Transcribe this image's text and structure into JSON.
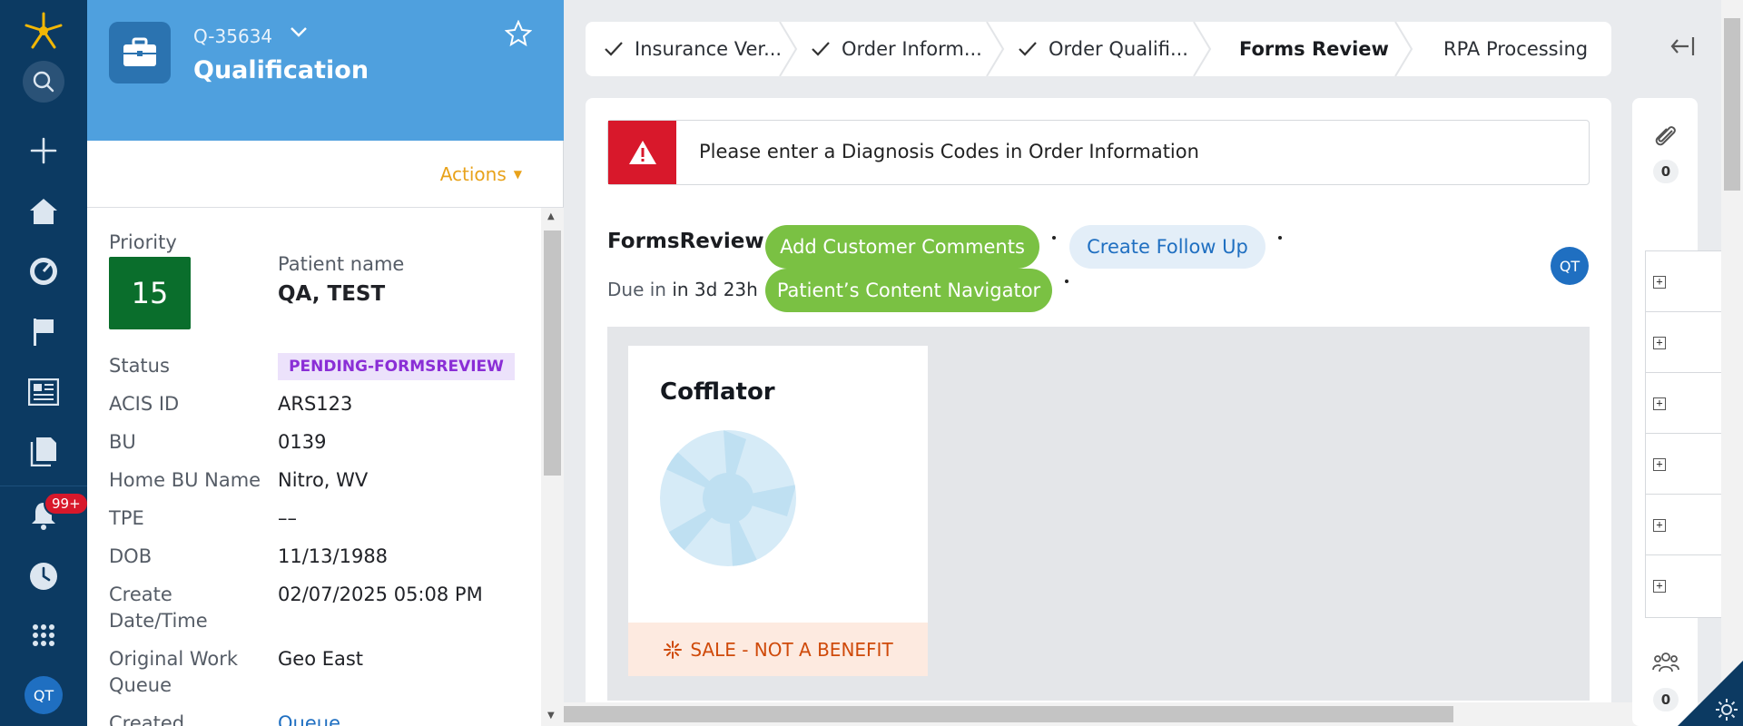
{
  "app": {
    "accent_color": "#0c3a62",
    "notifications_badge": "99+",
    "user_initials": "QT"
  },
  "rail": {
    "icons": [
      "logo-icon",
      "search-icon",
      "plus-icon",
      "home-icon",
      "dashboard-icon",
      "flag-icon",
      "news-icon",
      "documents-icon",
      "bell-icon",
      "history-icon",
      "apps-grid-icon"
    ]
  },
  "case": {
    "id": "Q-35634",
    "title": "Qualification",
    "actions_label": "Actions",
    "priority_label": "Priority",
    "priority_value": "15",
    "patient_name_label": "Patient name",
    "patient_name_value": "QA, TEST",
    "fields": [
      {
        "label": "Status",
        "value": "PENDING-FORMSREVIEW"
      },
      {
        "label": "ACIS ID",
        "value": "ARS123"
      },
      {
        "label": "BU",
        "value": "0139"
      },
      {
        "label": "Home BU Name",
        "value": "Nitro, WV"
      },
      {
        "label": "TPE",
        "value": "––"
      },
      {
        "label": "DOB",
        "value": "11/13/1988"
      },
      {
        "label_line1": "Create",
        "label_line2": "Date/Time",
        "value": "02/07/2025 05:08 PM"
      },
      {
        "label_line1": "Original Work",
        "label_line2": "Queue",
        "value": "Geo East"
      },
      {
        "label": "Created",
        "value": "Queue"
      }
    ]
  },
  "stages": [
    {
      "label": "Insurance Ver...",
      "done": true
    },
    {
      "label": "Order Inform...",
      "done": true
    },
    {
      "label": "Order Qualifi...",
      "done": true
    },
    {
      "label": "Forms Review",
      "done": false,
      "active": true
    },
    {
      "label": "RPA Processing",
      "done": false
    }
  ],
  "alert": {
    "message": "Please enter a Diagnosis Codes in Order Information",
    "color": "#d8182b"
  },
  "forms_review": {
    "title": "FormsReview",
    "due_label": "Due in",
    "due_value": "in 3d 23h",
    "buttons": {
      "add_comments": "Add Customer Comments",
      "create_follow_up": "Create Follow Up",
      "content_navigator": "Patient’s Content Navigator"
    },
    "assignee_initials": "QT"
  },
  "product": {
    "name": "Cofflator",
    "tag": "SALE - NOT A BENEFIT"
  },
  "util": {
    "attachments_count": "0",
    "followers_count": "0"
  }
}
